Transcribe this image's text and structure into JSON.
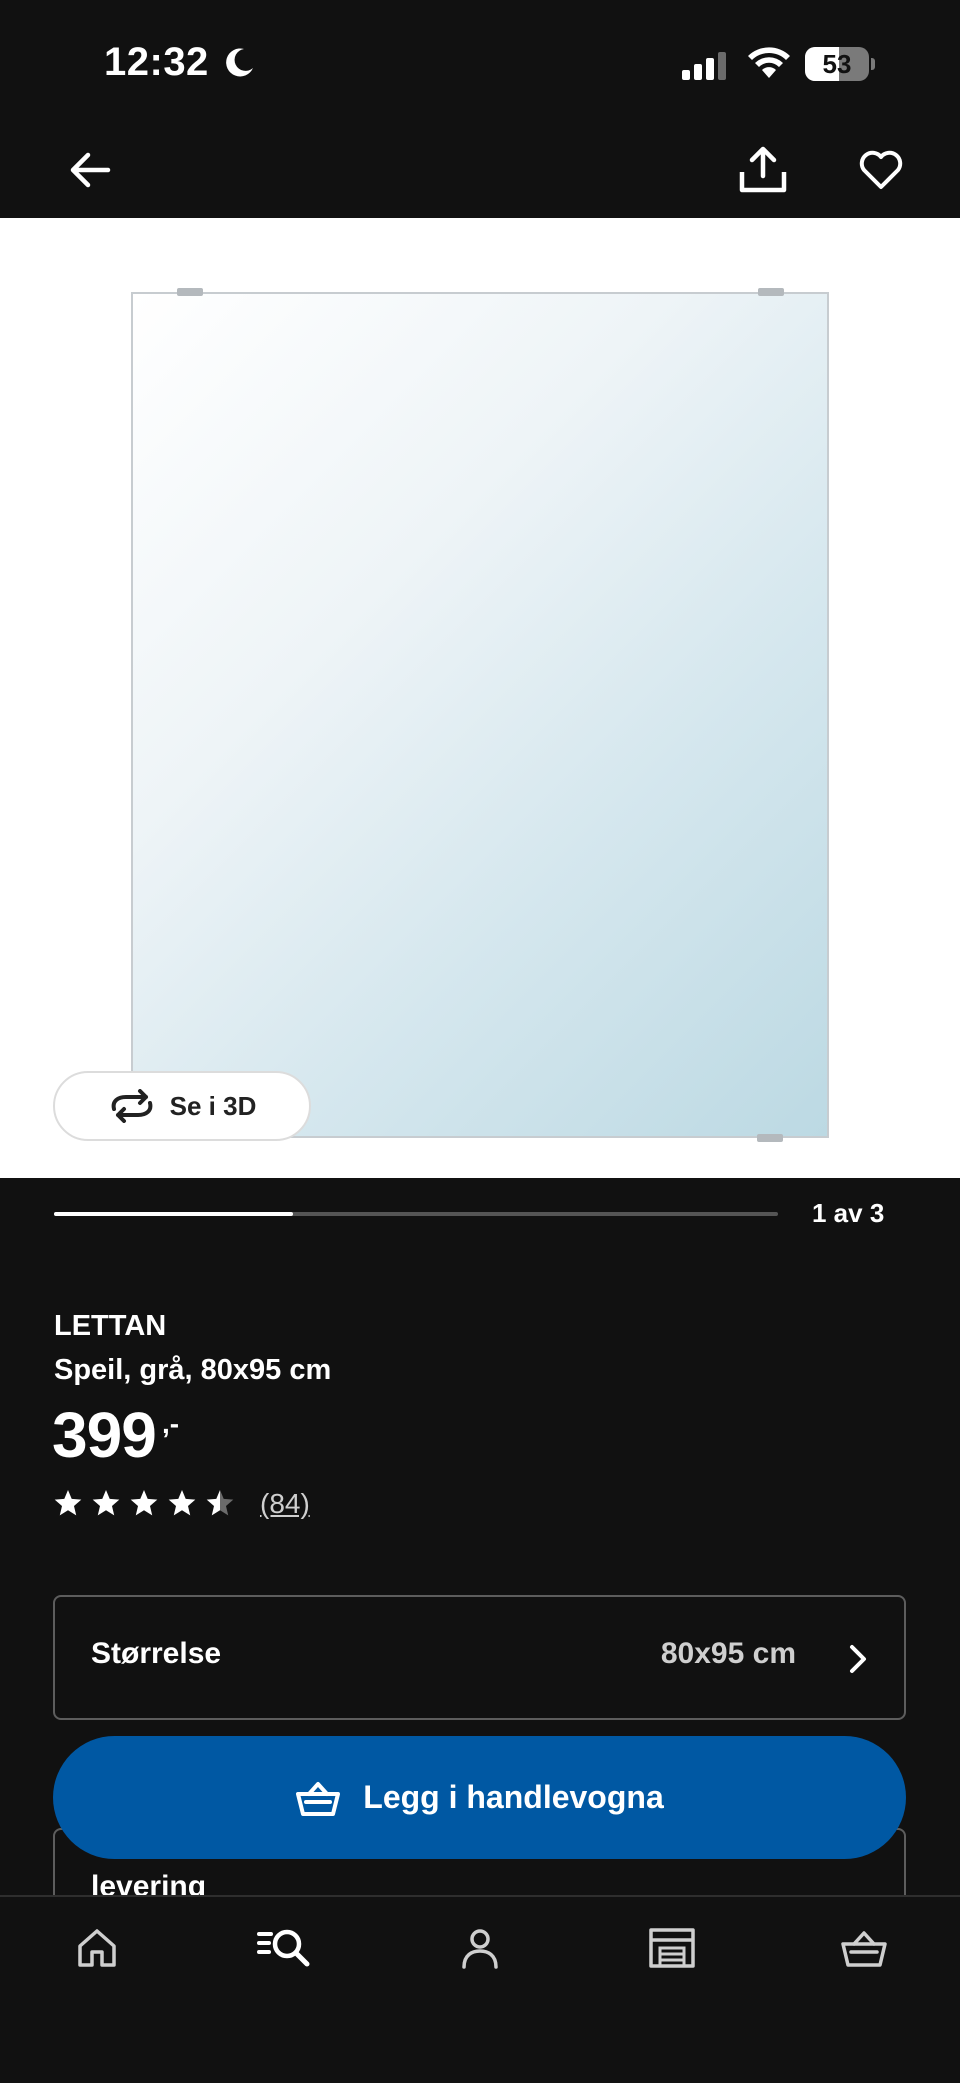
{
  "status_bar": {
    "time": "12:32",
    "battery_percent": "53",
    "battery_level": 0.53
  },
  "icons": {
    "back": "arrow-left-icon",
    "share": "share-icon",
    "favourite": "heart-icon",
    "rotate_3d": "rotate-360-icon",
    "cart": "shopping-basket-icon",
    "chevron": "chevron-right-icon"
  },
  "product": {
    "view_3d_label": "Se i 3D",
    "image_counter": "1 av 3",
    "image_progress": 0.33,
    "brand": "LETTAN",
    "description": "Speil, grå, 80x95 cm",
    "price": "399",
    "price_suffix": ",-",
    "rating_value": 4.5,
    "rating_count": "(84)"
  },
  "size_selector": {
    "label": "Størrelse",
    "value": "80x95 cm"
  },
  "delivery": {
    "label": "levering"
  },
  "add_to_cart": {
    "label": "Legg i handlevogna"
  },
  "tab_bar": {
    "items": [
      "home-icon",
      "search-icon",
      "profile-icon",
      "store-icon",
      "cart-icon"
    ]
  },
  "colors": {
    "background": "#111111",
    "accent": "#0058a3",
    "text": "#ffffff"
  }
}
